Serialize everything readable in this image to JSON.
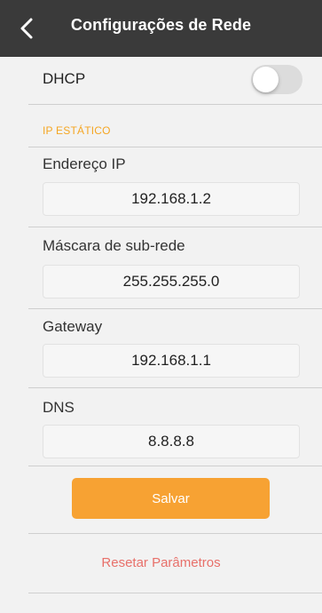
{
  "header": {
    "title": "Configurações de Rede",
    "back_icon": "chevron-left-icon"
  },
  "dhcp": {
    "label": "DHCP",
    "enabled": false
  },
  "static_ip": {
    "section_title": "IP ESTÁTICO",
    "fields": [
      {
        "label": "Endereço IP",
        "value": "192.168.1.2"
      },
      {
        "label": "Máscara de sub-rede",
        "value": "255.255.255.0"
      },
      {
        "label": "Gateway",
        "value": "192.168.1.1"
      },
      {
        "label": "DNS",
        "value": "8.8.8.8"
      }
    ]
  },
  "actions": {
    "save_label": "Salvar",
    "reset_label": "Resetar Parâmetros"
  },
  "colors": {
    "navbar": "#3a3a3a",
    "accent": "#f7a233",
    "reset": "#e8706a",
    "background": "#f2f2f2"
  }
}
